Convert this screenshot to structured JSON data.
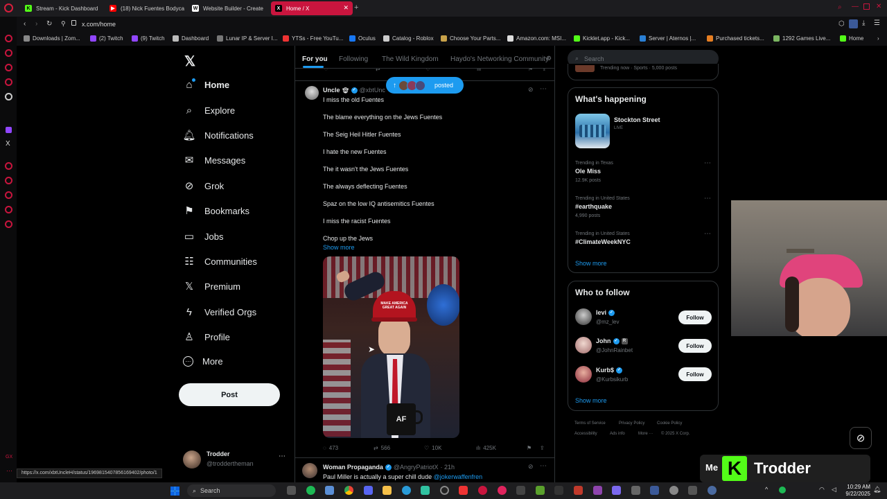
{
  "browser": {
    "tabs": [
      {
        "title": "Stream - Kick Dashboard",
        "color": "#53fc18"
      },
      {
        "title": "(18) Nick Fuentes Bodyca",
        "color": "#ff0000"
      },
      {
        "title": "Website Builder - Create",
        "color": "#ffffff"
      },
      {
        "title": "Home / X",
        "color": "#000000"
      }
    ],
    "url": "x.com/home",
    "bookmarks": [
      {
        "label": "Downloads | Zom...",
        "color": "#888"
      },
      {
        "label": "(2) Twitch",
        "color": "#9146ff"
      },
      {
        "label": "(9) Twitch",
        "color": "#9146ff"
      },
      {
        "label": "Dashboard",
        "color": "#bbb"
      },
      {
        "label": "Lunar IP & Server I...",
        "color": "#777"
      },
      {
        "label": "YTSs - Free YouTu...",
        "color": "#e33"
      },
      {
        "label": "Oculus",
        "color": "#1877f2"
      },
      {
        "label": "Catalog - Roblox",
        "color": "#ccc"
      },
      {
        "label": "Choose Your Parts...",
        "color": "#c8a24a"
      },
      {
        "label": "Amazon.com: MSI...",
        "color": "#ddd"
      },
      {
        "label": "Kicklet.app - Kick...",
        "color": "#53fc18"
      },
      {
        "label": "Server | Aternos |...",
        "color": "#2a7fd4"
      },
      {
        "label": "Purchased tickets...",
        "color": "#e67e22"
      },
      {
        "label": "1292 Games Live...",
        "color": "#7bb661"
      },
      {
        "label": "Home",
        "color": "#53fc18"
      }
    ],
    "status_url": "https://x.com/xbtUncleH/status/1969815407856169402/photo/1"
  },
  "sidebar": {
    "items": [
      {
        "label": "Home",
        "icon": "home-icon",
        "glyph": "⌂"
      },
      {
        "label": "Explore",
        "icon": "search-icon",
        "glyph": "⌕"
      },
      {
        "label": "Notifications",
        "icon": "bell-icon",
        "glyph": "🔔︎"
      },
      {
        "label": "Messages",
        "icon": "envelope-icon",
        "glyph": "✉"
      },
      {
        "label": "Grok",
        "icon": "grok-icon",
        "glyph": "⊘"
      },
      {
        "label": "Bookmarks",
        "icon": "bookmark-icon",
        "glyph": "⚑"
      },
      {
        "label": "Jobs",
        "icon": "briefcase-icon",
        "glyph": "▭"
      },
      {
        "label": "Communities",
        "icon": "people-icon",
        "glyph": "☷"
      },
      {
        "label": "Premium",
        "icon": "x-logo-icon",
        "glyph": "𝕏"
      },
      {
        "label": "Verified Orgs",
        "icon": "lightning-icon",
        "glyph": "ϟ"
      },
      {
        "label": "Profile",
        "icon": "person-icon",
        "glyph": "♙"
      },
      {
        "label": "More",
        "icon": "more-circle-icon",
        "glyph": "⋯"
      }
    ],
    "post_label": "Post",
    "account": {
      "name": "Trodder",
      "handle": "@troddertheman"
    }
  },
  "feed": {
    "tabs": [
      "For you",
      "Following",
      "The Wild Kingdom",
      "Haydo's Networking Community"
    ],
    "new_posts_pill": "posted",
    "tweet": {
      "author": "Uncle",
      "handle": "@xbtUnc",
      "lines": [
        "I miss the old Fuentes",
        "The blame everything on the Jews Fuentes",
        "The Seig Heil Hitler Fuentes",
        "I hate the new Fuentes",
        "The it wasn't the Jews Fuentes",
        "The always deflecting Fuentes",
        "Spaz on the low IQ antisemitics Fuentes",
        "I miss the racist Fuentes",
        "Chop up the Jews"
      ],
      "show_more": "Show more",
      "image_text": "MAKE AMERICA GREAT AGAIN",
      "mug_text": "AF",
      "stats": {
        "replies": "473",
        "reposts": "566",
        "likes": "10K",
        "views": "425K"
      }
    },
    "next_tweet": {
      "author": "Woman Propaganda",
      "handle": "@AngryPatriotX",
      "time": "· 21h",
      "text": "Paul Miller is actually a super chill dude",
      "mention": "@jokerwaffenfren"
    }
  },
  "right": {
    "search_placeholder": "Search",
    "top_fragment": "Trending now · Sports · 5,000 posts",
    "whats_happening": "What's happening",
    "event": {
      "title": "Stockton Street",
      "status": "LIVE"
    },
    "trends": [
      {
        "context": "Trending in Texas",
        "name": "Ole Miss",
        "posts": "12.9K posts"
      },
      {
        "context": "Trending in United States",
        "name": "#earthquake",
        "posts": "4,990 posts"
      },
      {
        "context": "Trending in United States",
        "name": "#ClimateWeekNYC",
        "posts": ""
      }
    ],
    "show_more": "Show more",
    "who_to_follow": "Who to follow",
    "follow_label": "Follow",
    "suggestions": [
      {
        "name": "levi",
        "handle": "@mz_lev"
      },
      {
        "name": "John",
        "handle": "@JohnRainbet"
      },
      {
        "name": "Kurb$",
        "handle": "@Kurbsikurb"
      }
    ],
    "footer": [
      "Terms of Service",
      "Privacy Policy",
      "Cookie Policy",
      "Accessibility",
      "Ads info",
      "More ···",
      "© 2025 X Corp."
    ]
  },
  "overlay": {
    "brand": "Trodder",
    "me": "Me"
  },
  "taskbar": {
    "search": "Search",
    "time": "10:29 AM",
    "date": "9/22/2025"
  }
}
